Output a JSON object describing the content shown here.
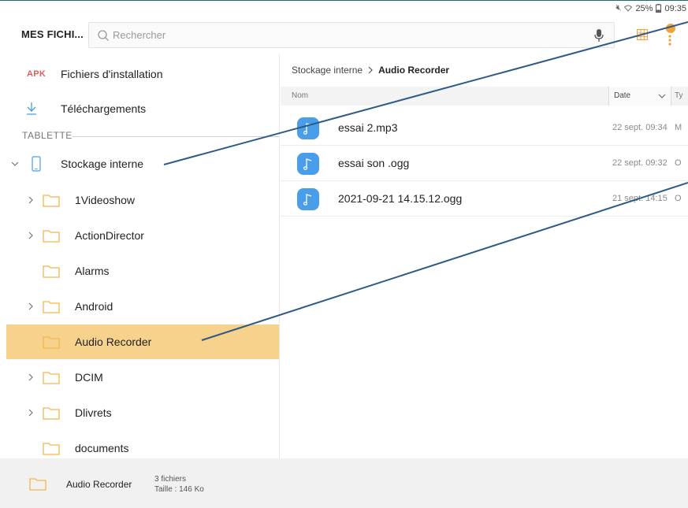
{
  "status_bar": {
    "signal_icon": "mute-icon",
    "wifi_icon": "wifi-icon",
    "battery_text": "25%",
    "battery_icon": "battery-icon",
    "time": "09:35"
  },
  "header": {
    "title": "MES FICHI...",
    "search_placeholder": "Rechercher",
    "search_value": "",
    "icons": [
      "search-icon",
      "microphone-icon",
      "grid-view-icon",
      "more-options-icon"
    ],
    "notification_badge": "",
    "accent_color": "#f2a23a"
  },
  "sidebar": {
    "apk_badge": "APK",
    "installation_label": "Fichiers d'installation",
    "downloads_label": "Téléchargements",
    "section_title": "TABLETTE",
    "storage_label": "Stockage interne",
    "folders": [
      {
        "label": "1Videoshow",
        "expandable": true
      },
      {
        "label": "ActionDirector",
        "expandable": true
      },
      {
        "label": "Alarms",
        "expandable": false
      },
      {
        "label": "Android",
        "expandable": true
      },
      {
        "label": "Audio Recorder",
        "expandable": false,
        "selected": true
      },
      {
        "label": "DCIM",
        "expandable": true
      },
      {
        "label": "Dlivrets",
        "expandable": true
      },
      {
        "label": "documents",
        "expandable": false
      }
    ],
    "selected_color": "#f6d28c",
    "folder_color": "#f2b84b"
  },
  "content": {
    "breadcrumb": {
      "root": "Stockage interne",
      "current": "Audio Recorder"
    },
    "columns": {
      "name": "Nom",
      "date": "Date",
      "type": "Ty"
    },
    "files": [
      {
        "name": "essai 2.mp3",
        "date": "22 sept. 09:34",
        "type": "M"
      },
      {
        "name": "essai son .ogg",
        "date": "22 sept. 09:32",
        "type": "O"
      },
      {
        "name": "2021-09-21 14.15.12.ogg",
        "date": "21 sept. 14:15",
        "type": "O"
      }
    ],
    "file_icon": "music-note-icon",
    "file_icon_color": "#4a9de8"
  },
  "footer": {
    "folder_name": "Audio Recorder",
    "file_count": "3 fichiers",
    "size": "Taille : 146 Ko"
  }
}
